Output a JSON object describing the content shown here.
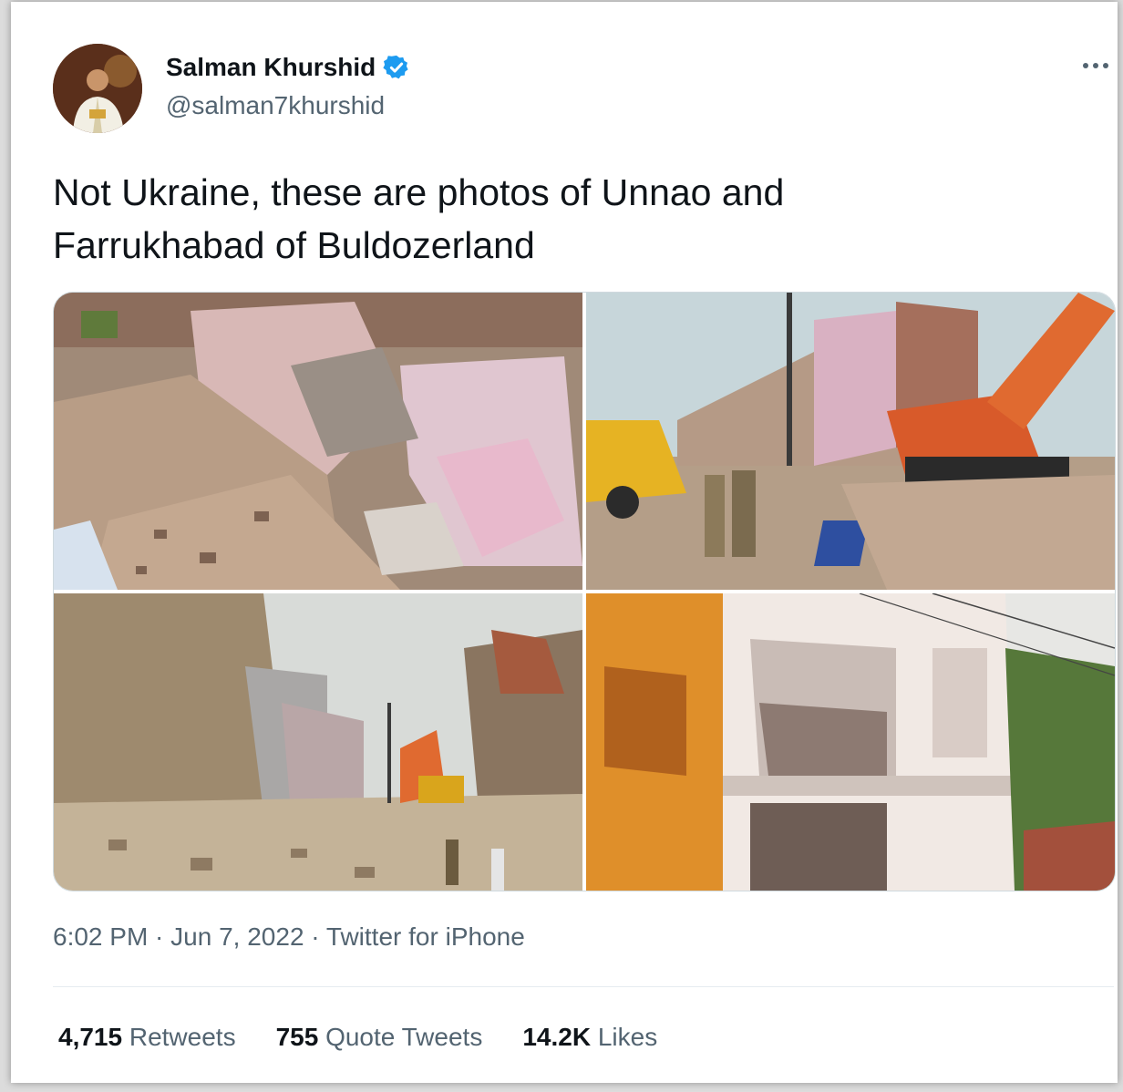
{
  "author": {
    "name": "Salman Khurshid",
    "handle": "@salman7khurshid",
    "verified_color": "#1d9bf0"
  },
  "tweet": {
    "text_line1": "Not Ukraine, these are photos of Unnao and",
    "text_line2": "Farrukhabad of Buldozerland"
  },
  "meta": {
    "time": "6:02 PM",
    "date": "Jun 7, 2022",
    "source": "Twitter for iPhone",
    "sep": " · "
  },
  "stats": {
    "retweets_count": "4,715",
    "retweets_label": "Retweets",
    "quotes_count": "755",
    "quotes_label": "Quote Tweets",
    "likes_count": "14.2K",
    "likes_label": "Likes"
  },
  "icons": {
    "more": "more-icon",
    "verified": "verified-icon"
  }
}
